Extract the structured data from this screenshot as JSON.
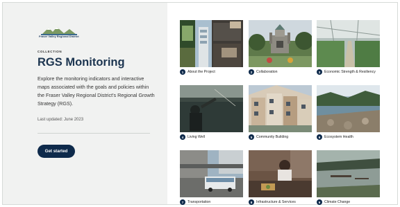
{
  "header": {
    "logo_text": "Fraser Valley Regional District",
    "collection_label": "COLLECTION",
    "title": "RGS Monitoring",
    "description": "Explore the monitoring indicators and interactive maps associated with the goals and policies within the Fraser Valley Regional District's Regional Growth Strategy (RGS).",
    "updated": "Last updated: June 2023",
    "button_label": "Get started"
  },
  "tiles": [
    {
      "num": "1",
      "label": "About the Project"
    },
    {
      "num": "2",
      "label": "Collaboration"
    },
    {
      "num": "3",
      "label": "Economic Strength & Resiliency"
    },
    {
      "num": "4",
      "label": "Living Well"
    },
    {
      "num": "5",
      "label": "Community Building"
    },
    {
      "num": "6",
      "label": "Ecosystem Health"
    },
    {
      "num": "7",
      "label": "Transportation"
    },
    {
      "num": "8",
      "label": "Infrastructure & Services"
    },
    {
      "num": "9",
      "label": "Climate Change"
    }
  ],
  "colors": {
    "accent": "#0e2a4b",
    "title": "#1c3550",
    "panel_bg": "#f1f2f1"
  }
}
